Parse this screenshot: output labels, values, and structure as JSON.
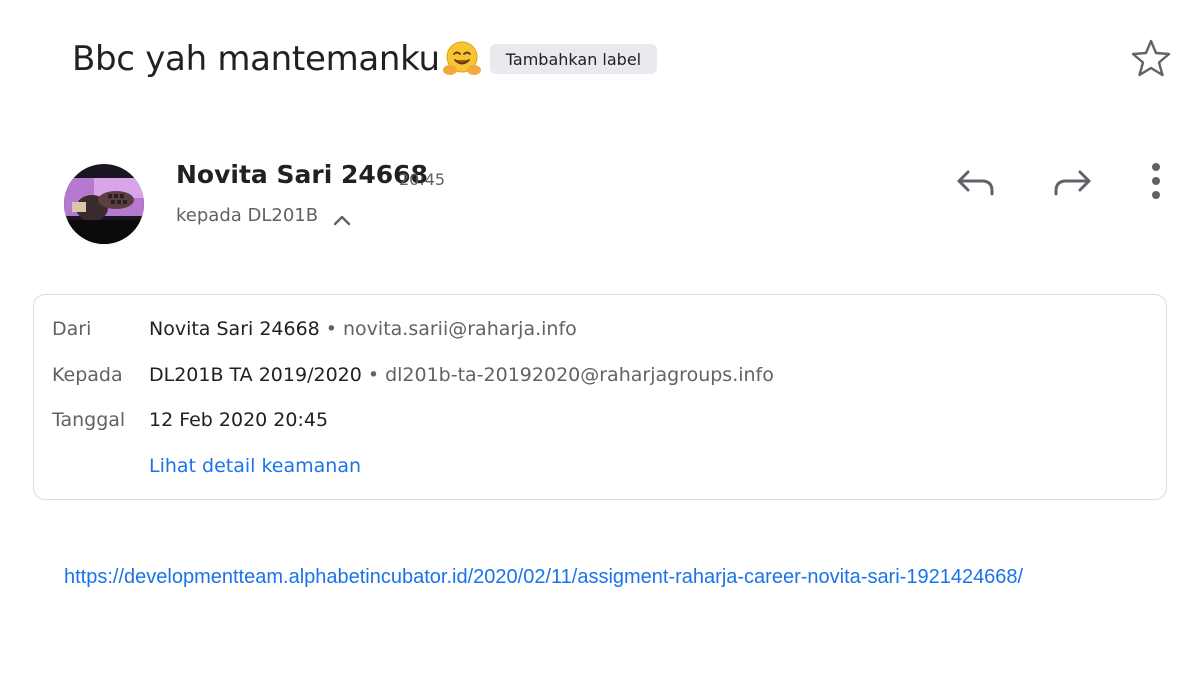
{
  "subject": {
    "title": "Bbc yah mantemanku",
    "emoji_icon": "hugging-face-icon",
    "label_button": "Tambahkan label",
    "star_icon": "star-outline-icon"
  },
  "sender": {
    "name": "Novita Sari 24668",
    "time": "20:45",
    "recipient_summary": "kepada DL201B",
    "avatar": "profile-photo",
    "toggle_icon": "chevron-up-icon"
  },
  "actions": {
    "reply_icon": "reply-icon",
    "forward_icon": "forward-icon",
    "more_icon": "more-vertical-icon"
  },
  "details": {
    "from_label": "Dari",
    "from_name": "Novita Sari 24668",
    "from_email": "novita.sarii@raharja.info",
    "to_label": "Kepada",
    "to_name": "DL201B TA 2019/2020",
    "to_email": "dl201b-ta-20192020@raharjagroups.info",
    "date_label": "Tanggal",
    "date_value": "12 Feb 2020 20:45",
    "security_link": "Lihat detail keamanan",
    "separator": "•"
  },
  "body": {
    "link": "https://developmentteam.alphabetincubator.id/2020/02/11/assigment-raharja-career-novita-sari-1921424668/"
  },
  "colors": {
    "accent": "#1a73e8",
    "text_primary": "#202124",
    "text_secondary": "#5f6368",
    "chip_bg": "#e8eaed",
    "border": "#dadce0"
  }
}
